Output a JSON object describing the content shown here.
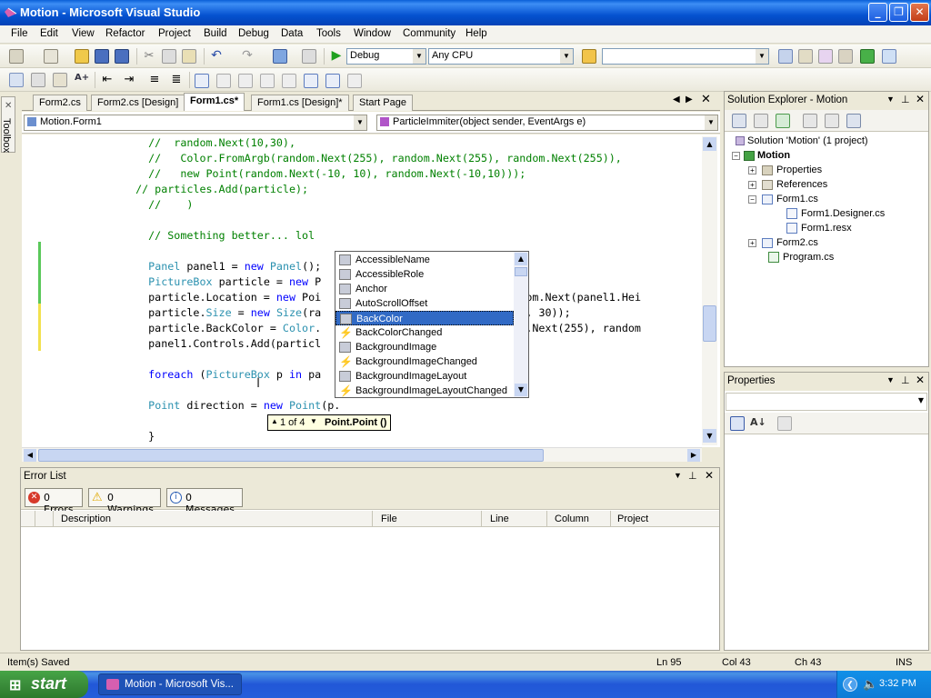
{
  "window": {
    "title": "Motion - Microsoft Visual Studio",
    "min_label": "_",
    "max_label": "❐",
    "close_label": "✕"
  },
  "menu": [
    "File",
    "Edit",
    "View",
    "Refactor",
    "Project",
    "Build",
    "Debug",
    "Data",
    "Tools",
    "Window",
    "Community",
    "Help"
  ],
  "toolbar": {
    "config": "Debug",
    "platform": "Any CPU",
    "find_value": ""
  },
  "toolbox_label": "Toolbox",
  "tabs": [
    {
      "label": "Form2.cs",
      "active": false
    },
    {
      "label": "Form2.cs [Design]",
      "active": false
    },
    {
      "label": "Form1.cs*",
      "active": true
    },
    {
      "label": "Form1.cs [Design]*",
      "active": false
    },
    {
      "label": "Start Page",
      "active": false
    }
  ],
  "nav": {
    "class_combo": "Motion.Form1",
    "member_combo": "ParticleImmiter(object sender, EventArgs e)"
  },
  "code_lines": [
    "    //  random.Next(10,30),",
    "    //   Color.FromArgb(random.Next(255), random.Next(255), random.Next(255)),",
    "    //   new Point(random.Next(-10, 10), random.Next(-10,10)));",
    "  // particles.Add(particle);",
    "    //    )",
    "",
    "    // Something better... lol",
    "",
    "    Panel panel1 = new Panel();",
    "    PictureBox particle = new P",
    "    particle.Location = new Poi                          , random.Next(panel1.Hei",
    "    particle.Size = new Size(ra                          ext(10, 30));",
    "    particle.BackColor = Color.                          random.Next(255), random",
    "    panel1.Controls.Add(particl",
    "",
    "    foreach (PictureBox p in pa",
    "",
    "    Point direction = new Point(p.",
    "",
    "    }"
  ],
  "intellisense": {
    "items": [
      "AccessibleName",
      "AccessibleRole",
      "Anchor",
      "AutoScrollOffset",
      "BackColor",
      "BackColorChanged",
      "BackgroundImage",
      "BackgroundImageChanged",
      "BackgroundImageLayout",
      "BackgroundImageLayoutChanged"
    ],
    "kinds": [
      "prop",
      "prop",
      "prop",
      "prop",
      "prop",
      "event",
      "prop",
      "event",
      "prop",
      "event"
    ],
    "selected": "BackColor"
  },
  "param_tip": {
    "counter": "1 of 4",
    "signature": "Point.Point ()"
  },
  "error_list": {
    "title": "Error List",
    "errors": "0 Errors",
    "warnings": "0 Warnings",
    "messages": "0 Messages",
    "columns": [
      "Description",
      "File",
      "Line",
      "Column",
      "Project"
    ]
  },
  "solution_explorer": {
    "title": "Solution Explorer - Motion",
    "solution": "Solution 'Motion' (1 project)",
    "project": "Motion",
    "items": [
      {
        "label": "Properties",
        "indent": 2,
        "expander": "+"
      },
      {
        "label": "References",
        "indent": 2,
        "expander": "+"
      },
      {
        "label": "Form1.cs",
        "indent": 2,
        "expander": "−"
      },
      {
        "label": "Form1.Designer.cs",
        "indent": 3,
        "expander": ""
      },
      {
        "label": "Form1.resx",
        "indent": 3,
        "expander": ""
      },
      {
        "label": "Form2.cs",
        "indent": 2,
        "expander": "+"
      },
      {
        "label": "Program.cs",
        "indent": 2,
        "expander": ""
      }
    ]
  },
  "properties": {
    "title": "Properties"
  },
  "status": {
    "message": "Item(s) Saved",
    "ln": "Ln 95",
    "col": "Col 43",
    "ch": "Ch 43",
    "mode": "INS"
  },
  "taskbar": {
    "start": "start",
    "item": "Motion - Microsoft Vis...",
    "time": "3:32 PM"
  }
}
